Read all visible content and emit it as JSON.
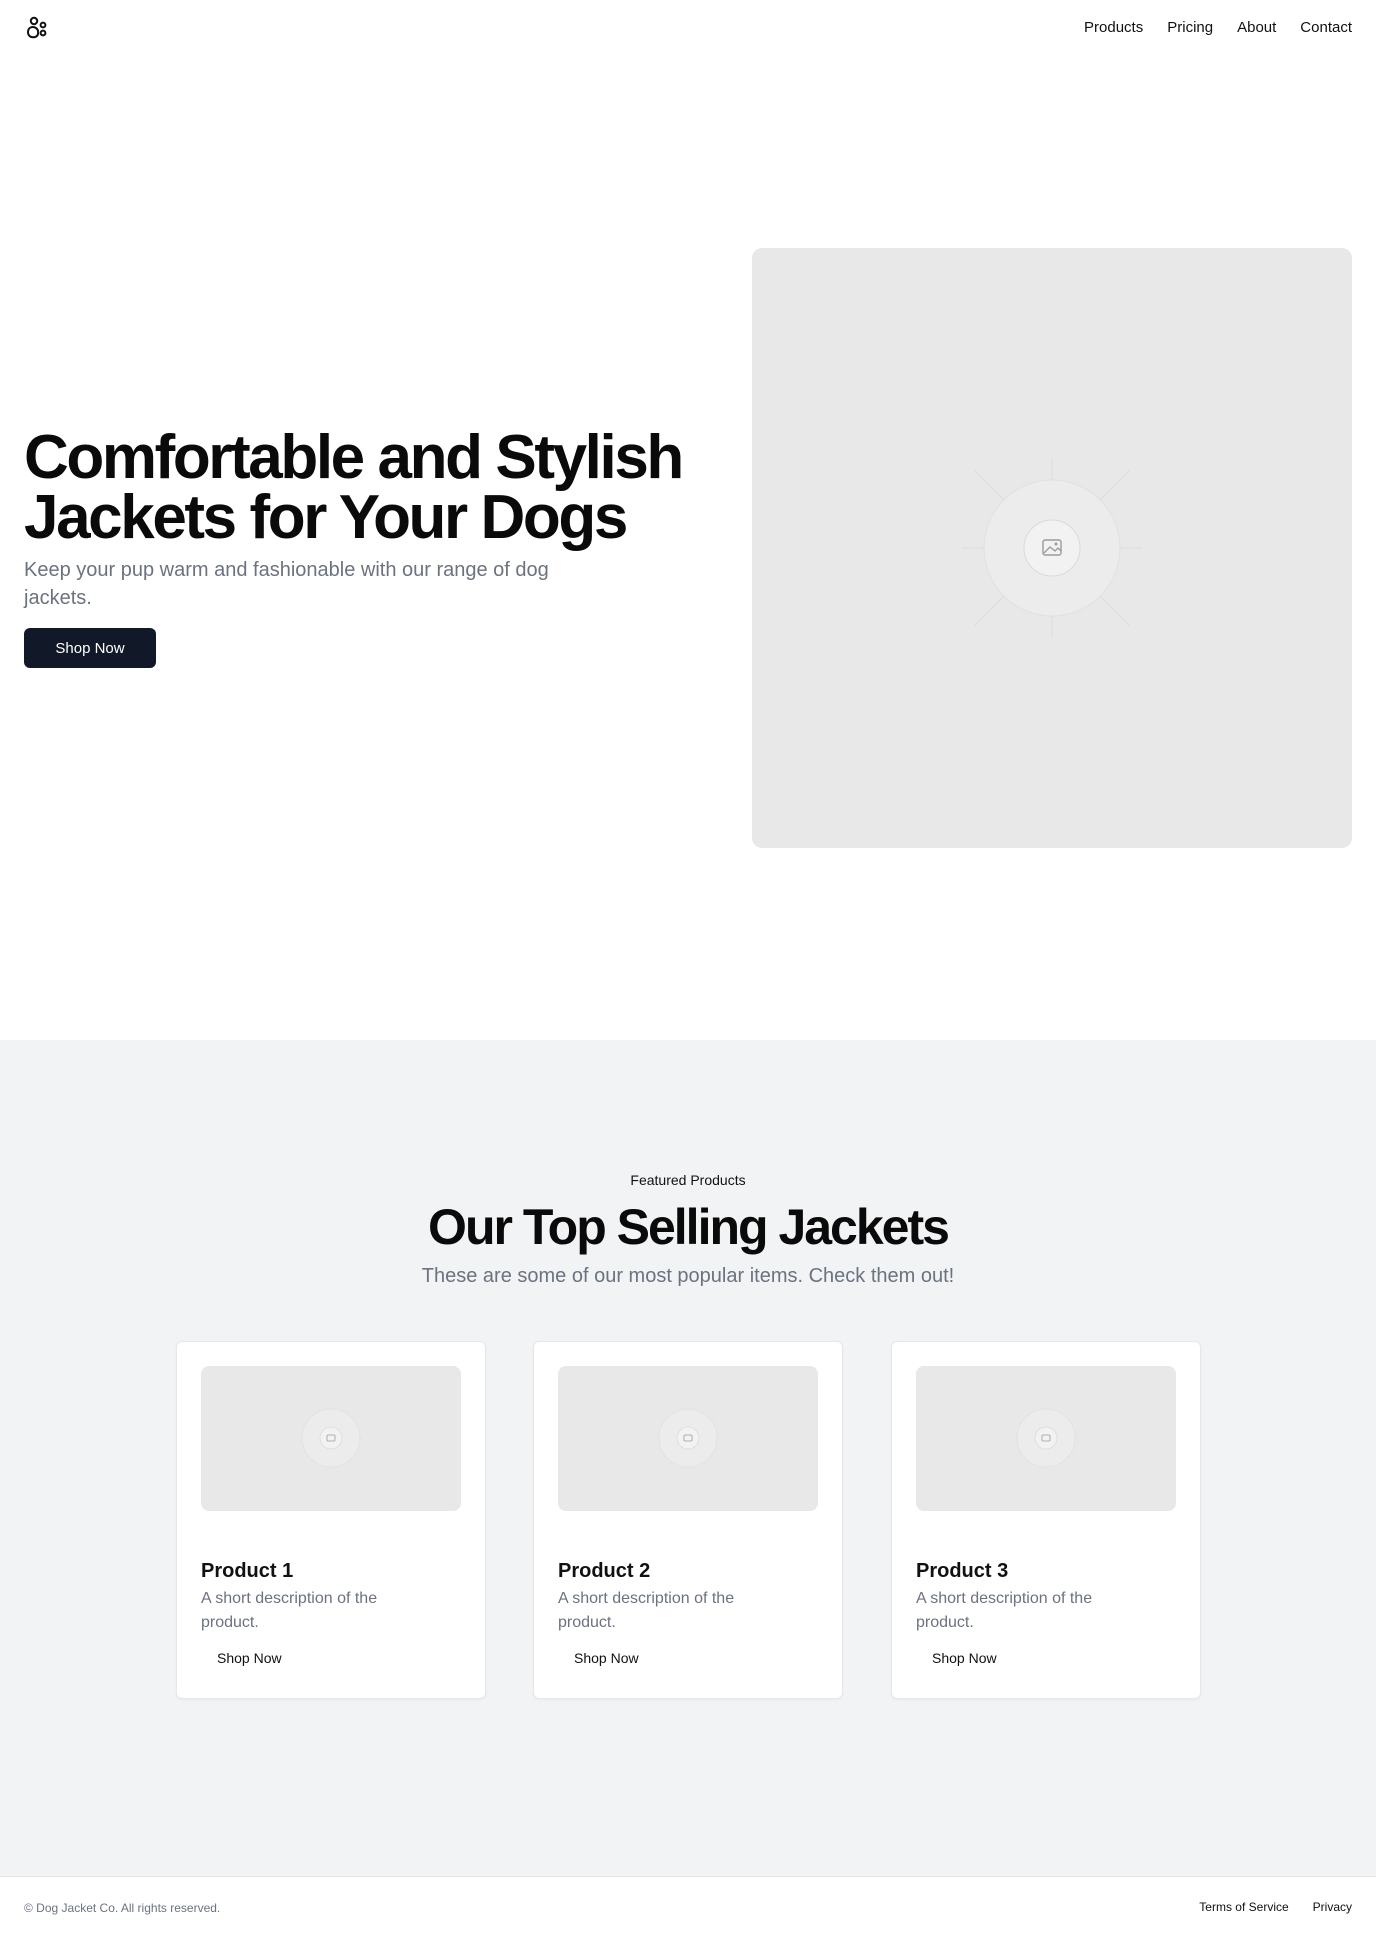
{
  "header": {
    "logo_icon": "paw-icon",
    "nav": [
      {
        "label": "Products"
      },
      {
        "label": "Pricing"
      },
      {
        "label": "About"
      },
      {
        "label": "Contact"
      }
    ]
  },
  "hero": {
    "title": "Comfortable and Stylish Jackets for Your Dogs",
    "subtitle": "Keep your pup warm and fashionable with our range of dog jackets.",
    "cta_label": "Shop Now",
    "image_icon": "image-placeholder-icon"
  },
  "featured": {
    "eyebrow": "Featured Products",
    "title": "Our Top Selling Jackets",
    "subtitle": "These are some of our most popular items. Check them out!",
    "products": [
      {
        "title": "Product 1",
        "description": "A short description of the product.",
        "cta_label": "Shop Now"
      },
      {
        "title": "Product 2",
        "description": "A short description of the product.",
        "cta_label": "Shop Now"
      },
      {
        "title": "Product 3",
        "description": "A short description of the product.",
        "cta_label": "Shop Now"
      }
    ]
  },
  "footer": {
    "copyright": "© Dog Jacket Co. All rights reserved.",
    "links": [
      {
        "label": "Terms of Service"
      },
      {
        "label": "Privacy"
      }
    ]
  },
  "colors": {
    "primary_button": "#111827",
    "muted_text": "#6b7280",
    "section_bg": "#f2f3f5",
    "placeholder_bg": "#e8e8e8"
  }
}
